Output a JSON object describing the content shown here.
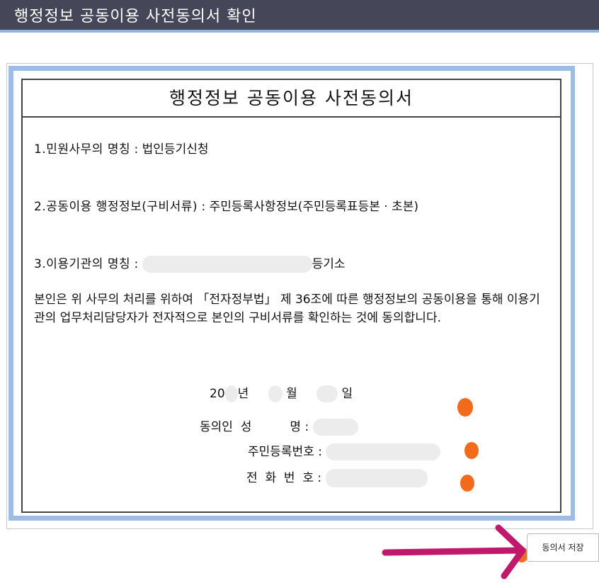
{
  "window": {
    "title": "행정정보 공동이용 사전동의서 확인"
  },
  "document": {
    "title": "행정정보 공동이용 사전동의서",
    "item1": {
      "label": "1.민원사무의 명칭",
      "sep": " : ",
      "value": "법인등기신청"
    },
    "item2": {
      "label": "2.공동이용 행정정보(구비서류)",
      "sep": " : ",
      "value": "주민등록사항정보(주민등록표등본 · 초본)"
    },
    "item3": {
      "label": "3.이용기관의 명칭",
      "sep": " : ",
      "value_suffix": "등기소"
    },
    "statement": "본인은 위 사무의 처리를 위하여 「전자정부법」 제 36조에 따른 행정정보의 공동이용을 통해 이용기관의 업무처리담당자가 전자적으로 본인의 구비서류를 확인하는 것에 동의합니다.",
    "date": {
      "year_prefix": "20",
      "year_label": "년",
      "month_label": "월",
      "day_label": "일"
    },
    "consenter": {
      "name_label": "동의인  성          명",
      "sep": " :"
    },
    "resident_no": {
      "label": "주민등록번호",
      "sep": " :"
    },
    "phone": {
      "label": "전  화  번  호",
      "sep": " :"
    }
  },
  "actions": {
    "save_label": "동의서 저장"
  },
  "colors": {
    "titlebar": "#454759",
    "frame_blue": "#9dbde3",
    "marker_dot": "#f26a1b",
    "arrow": "#c0186a"
  }
}
